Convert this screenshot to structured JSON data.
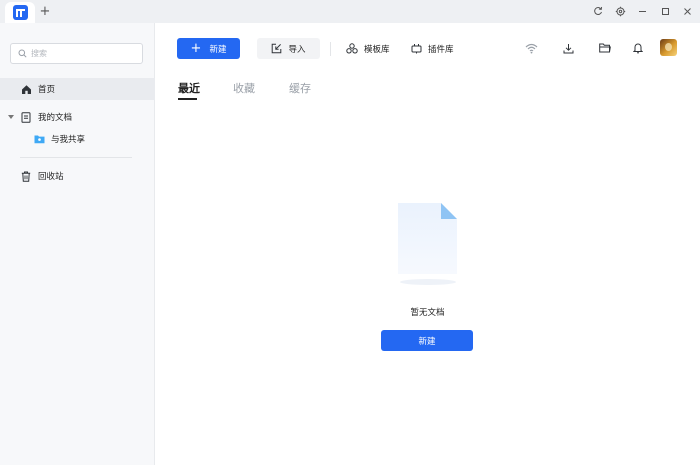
{
  "sidebar": {
    "search_placeholder": "搜索",
    "items": [
      {
        "label": "首页"
      },
      {
        "label": "我的文档"
      },
      {
        "label": "与我共享"
      },
      {
        "label": "回收站"
      }
    ]
  },
  "toolbar": {
    "new_label": "新建",
    "import_label": "导入",
    "templates_label": "模板库",
    "plugins_label": "插件库"
  },
  "tabs": [
    {
      "label": "最近",
      "active": true
    },
    {
      "label": "收藏",
      "active": false
    },
    {
      "label": "缓存",
      "active": false
    }
  ],
  "empty_state": {
    "message": "暂无文档",
    "new_button_label": "新建"
  },
  "colors": {
    "accent": "#2468f2",
    "titlebar_bg": "#eef0f3",
    "sidebar_bg": "#f7f8fa",
    "active_item_bg": "#e9ebef"
  },
  "icons": {
    "app_logo": "app-logo-icon",
    "new_tab": "plus-icon",
    "sync": "sync-icon",
    "settings": "gear-icon",
    "minimize": "minimize-icon",
    "maximize": "maximize-icon",
    "close": "close-icon",
    "wifi": "wifi-icon",
    "download": "download-icon",
    "folder": "folder-icon",
    "bell": "bell-icon"
  }
}
